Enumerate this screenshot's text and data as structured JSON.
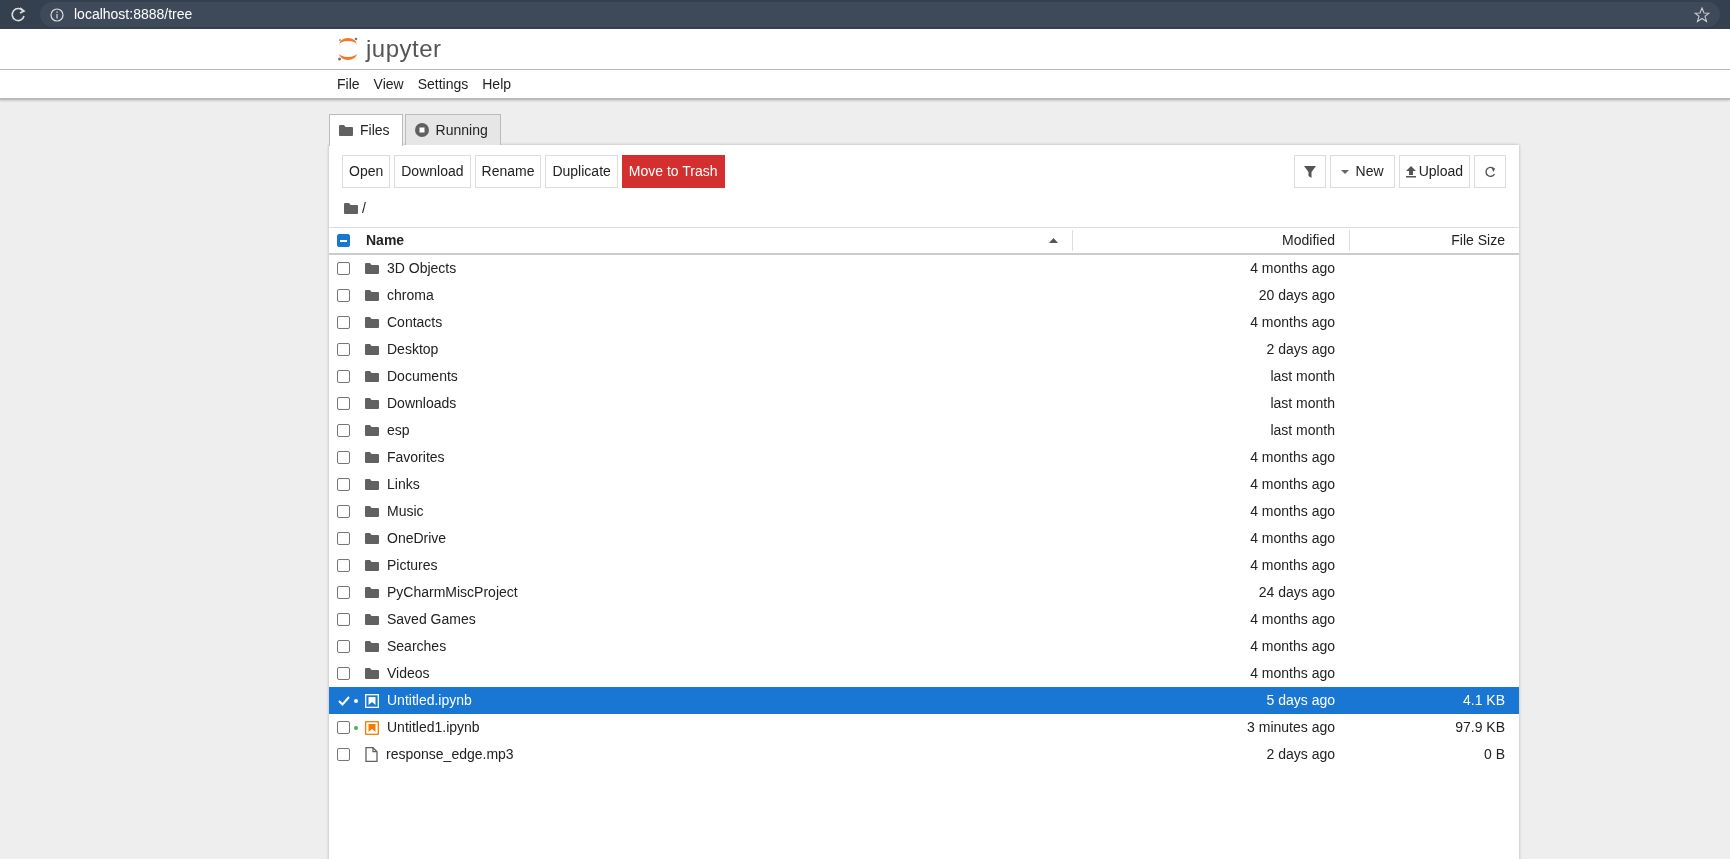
{
  "browser": {
    "url": "localhost:8888/tree"
  },
  "app": {
    "logo_text": "jupyter"
  },
  "menu": [
    "File",
    "View",
    "Settings",
    "Help"
  ],
  "tabs": [
    {
      "label": "Files",
      "kind": "folder",
      "selected": true
    },
    {
      "label": "Running",
      "kind": "stop",
      "selected": false
    }
  ],
  "actions": [
    {
      "label": "Open",
      "kind": "plain"
    },
    {
      "label": "Download",
      "kind": "plain"
    },
    {
      "label": "Rename",
      "kind": "plain"
    },
    {
      "label": "Duplicate",
      "kind": "plain"
    },
    {
      "label": "Move to Trash",
      "kind": "danger"
    }
  ],
  "tools": [
    {
      "kind": "filter"
    },
    {
      "kind": "new",
      "label": "New"
    },
    {
      "kind": "upload",
      "label": "Upload"
    },
    {
      "kind": "refresh"
    }
  ],
  "breadcrumb": "/",
  "table": {
    "select_all": {
      "indeterminate": true
    },
    "columns": [
      {
        "label": "Name",
        "sorted": true
      },
      {
        "label": "Modified",
        "sorted": false
      },
      {
        "label": "File Size",
        "sorted": false
      }
    ],
    "rows": [
      {
        "name": "3D Objects",
        "kind": "folder",
        "modified": "4 months ago",
        "selected": false,
        "running": false
      },
      {
        "name": "chroma",
        "kind": "folder",
        "modified": "20 days ago",
        "selected": false,
        "running": false
      },
      {
        "name": "Contacts",
        "kind": "folder",
        "modified": "4 months ago",
        "selected": false,
        "running": false
      },
      {
        "name": "Desktop",
        "kind": "folder",
        "modified": "2 days ago",
        "selected": false,
        "running": false
      },
      {
        "name": "Documents",
        "kind": "folder",
        "modified": "last month",
        "selected": false,
        "running": false
      },
      {
        "name": "Downloads",
        "kind": "folder",
        "modified": "last month",
        "selected": false,
        "running": false
      },
      {
        "name": "esp",
        "kind": "folder",
        "modified": "last month",
        "selected": false,
        "running": false
      },
      {
        "name": "Favorites",
        "kind": "folder",
        "modified": "4 months ago",
        "selected": false,
        "running": false
      },
      {
        "name": "Links",
        "kind": "folder",
        "modified": "4 months ago",
        "selected": false,
        "running": false
      },
      {
        "name": "Music",
        "kind": "folder",
        "modified": "4 months ago",
        "selected": false,
        "running": false
      },
      {
        "name": "OneDrive",
        "kind": "folder",
        "modified": "4 months ago",
        "selected": false,
        "running": false
      },
      {
        "name": "Pictures",
        "kind": "folder",
        "modified": "4 months ago",
        "selected": false,
        "running": false
      },
      {
        "name": "PyCharmMiscProject",
        "kind": "folder",
        "modified": "24 days ago",
        "selected": false,
        "running": false
      },
      {
        "name": "Saved Games",
        "kind": "folder",
        "modified": "4 months ago",
        "selected": false,
        "running": false
      },
      {
        "name": "Searches",
        "kind": "folder",
        "modified": "4 months ago",
        "selected": false,
        "running": false
      },
      {
        "name": "Videos",
        "kind": "folder",
        "modified": "4 months ago",
        "selected": false,
        "running": false
      },
      {
        "name": "Untitled.ipynb",
        "kind": "notebook",
        "modified": "5 days ago",
        "size": "4.1 KB",
        "selected": true,
        "running": true
      },
      {
        "name": "Untitled1.ipynb",
        "kind": "notebook",
        "modified": "3 minutes ago",
        "size": "97.9 KB",
        "selected": false,
        "running": true
      },
      {
        "name": "response_edge.mp3",
        "kind": "file",
        "modified": "2 days ago",
        "size": "0 B",
        "selected": false,
        "running": false
      }
    ]
  }
}
